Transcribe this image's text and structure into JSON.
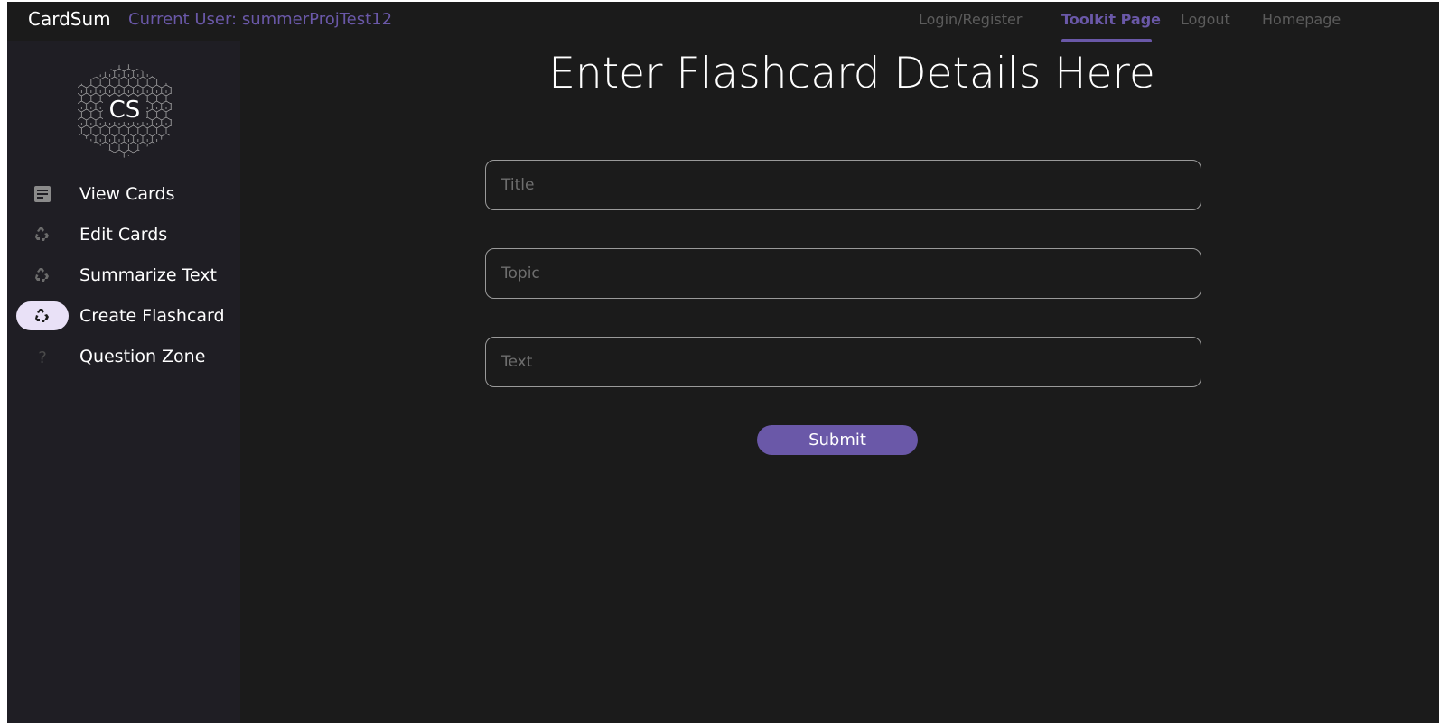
{
  "topbar": {
    "brand": "CardSum",
    "current_user": "Current User: summerProjTest12",
    "nav": [
      {
        "label": "Login/Register",
        "active": false
      },
      {
        "label": "Toolkit Page",
        "active": true
      },
      {
        "label": "Logout",
        "active": false
      },
      {
        "label": "Homepage",
        "active": false
      }
    ]
  },
  "sidebar": {
    "logo_text": "CS",
    "items": [
      {
        "label": "View Cards",
        "icon": "note-icon",
        "selected": false
      },
      {
        "label": "Edit Cards",
        "icon": "recycle-icon",
        "selected": false
      },
      {
        "label": "Summarize Text",
        "icon": "recycle-icon",
        "selected": false
      },
      {
        "label": "Create Flashcard",
        "icon": "recycle-icon",
        "selected": true
      },
      {
        "label": "Question Zone",
        "icon": "question-icon",
        "selected": false
      }
    ]
  },
  "main": {
    "title": "Enter Flashcard Details Here",
    "fields": [
      {
        "placeholder": "Title",
        "value": ""
      },
      {
        "placeholder": "Topic",
        "value": ""
      },
      {
        "placeholder": "Text",
        "value": ""
      }
    ],
    "submit_label": "Submit"
  },
  "colors": {
    "accent": "#6a58a8",
    "background": "#1b1b1b",
    "sidebar": "#1f1e24",
    "selected_pill": "#e9e1f7"
  }
}
